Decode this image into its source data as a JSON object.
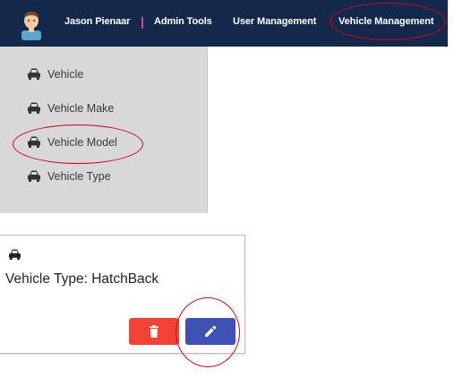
{
  "navbar": {
    "user_name": "Jason Pienaar",
    "separator": "|",
    "links": {
      "admin_tools": "Admin Tools",
      "user_management": "User Management",
      "vehicle_management": "Vehicle Management"
    }
  },
  "sidebar": {
    "items": [
      {
        "label": "Vehicle",
        "icon": "car-icon"
      },
      {
        "label": "Vehicle Make",
        "icon": "car-icon"
      },
      {
        "label": "Vehicle Model",
        "icon": "car-icon"
      },
      {
        "label": "Vehicle Type",
        "icon": "car-icon"
      }
    ]
  },
  "card": {
    "icon": "car-icon",
    "title": "Vehicle Type: HatchBack",
    "delete_icon": "trash-icon",
    "edit_icon": "pencil-icon"
  },
  "colors": {
    "navbar": "#13294b",
    "sidebar": "#d8d8d8",
    "delete_button": "#f44336",
    "edit_button": "#3f51b5",
    "annotation": "#d0021b",
    "separator": "#e84a8a"
  }
}
